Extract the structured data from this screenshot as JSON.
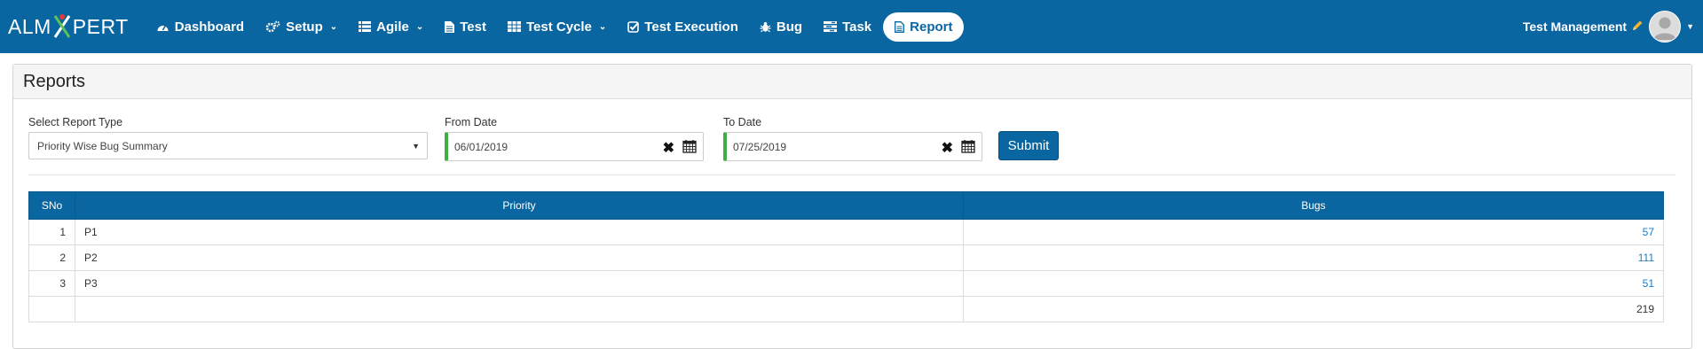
{
  "brand": {
    "pre": "ALM",
    "x": "X",
    "post": "PERT"
  },
  "nav": [
    {
      "label": "Dashboard",
      "icon": "dashboard-icon",
      "caret": false,
      "active": false
    },
    {
      "label": "Setup",
      "icon": "gears-icon",
      "caret": true,
      "active": false
    },
    {
      "label": "Agile",
      "icon": "list-icon",
      "caret": true,
      "active": false
    },
    {
      "label": "Test",
      "icon": "file-icon",
      "caret": false,
      "active": false
    },
    {
      "label": "Test Cycle",
      "icon": "table-icon",
      "caret": true,
      "active": false
    },
    {
      "label": "Test Execution",
      "icon": "check-square-icon",
      "caret": false,
      "active": false
    },
    {
      "label": "Bug",
      "icon": "bug-icon",
      "caret": false,
      "active": false
    },
    {
      "label": "Task",
      "icon": "tasks-icon",
      "caret": false,
      "active": false
    },
    {
      "label": "Report",
      "icon": "file-text-icon",
      "caret": false,
      "active": true
    }
  ],
  "user": {
    "name": "Test Management"
  },
  "page": {
    "title": "Reports"
  },
  "form": {
    "report_type_label": "Select Report Type",
    "report_type_value": "Priority Wise Bug Summary",
    "from_label": "From Date",
    "from_value": "06/01/2019",
    "to_label": "To Date",
    "to_value": "07/25/2019",
    "submit_label": "Submit"
  },
  "table": {
    "headers": [
      "SNo",
      "Priority",
      "Bugs"
    ],
    "rows": [
      {
        "sno": "1",
        "priority": "P1",
        "bugs": "57"
      },
      {
        "sno": "2",
        "priority": "P2",
        "bugs": "111"
      },
      {
        "sno": "3",
        "priority": "P3",
        "bugs": "51"
      }
    ],
    "total": "219"
  },
  "colors": {
    "navbar": "#0a66a0",
    "accent_green": "#3cb043",
    "link": "#1a7cc9"
  }
}
